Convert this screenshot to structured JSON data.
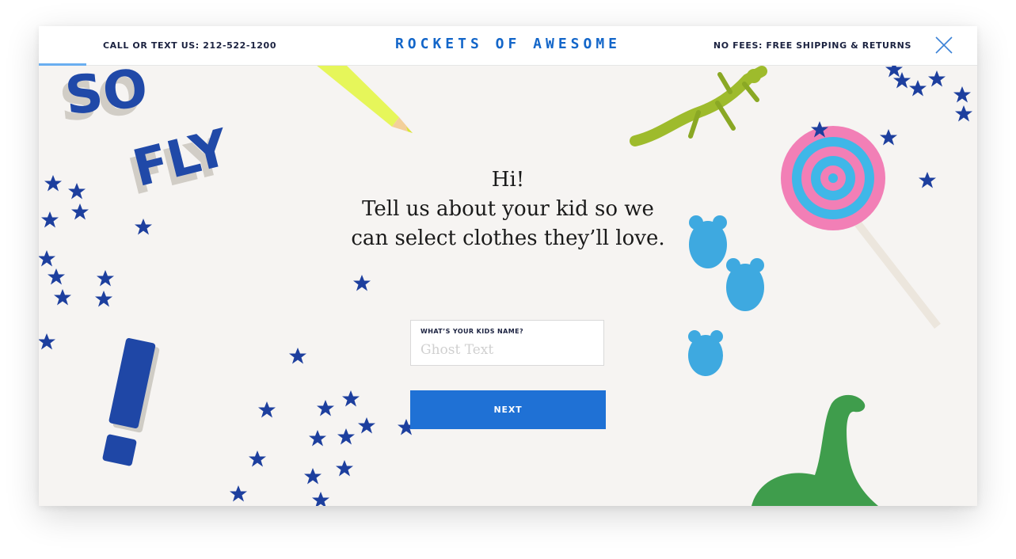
{
  "header": {
    "contact": "CALL OR TEXT US: 212-522-1200",
    "brand": "ROCKETS OF AWESOME",
    "fees": "NO FEES: FREE SHIPPING & RETURNS",
    "close_icon": "close-icon"
  },
  "decorations": {
    "letters": [
      "SO",
      "FLY",
      "!"
    ]
  },
  "intro": {
    "line1": "Hi!",
    "line2": "Tell us about your kid so we",
    "line3": "can select clothes they’ll love."
  },
  "form": {
    "name_label": "WHAT’S YOUR KIDS NAME?",
    "name_placeholder": "Ghost Text",
    "name_value": "",
    "next_label": "NEXT"
  },
  "colors": {
    "brand_blue": "#1366c9",
    "button_blue": "#1f71d5",
    "navy": "#1b2240",
    "background": "#f6f4f2"
  }
}
